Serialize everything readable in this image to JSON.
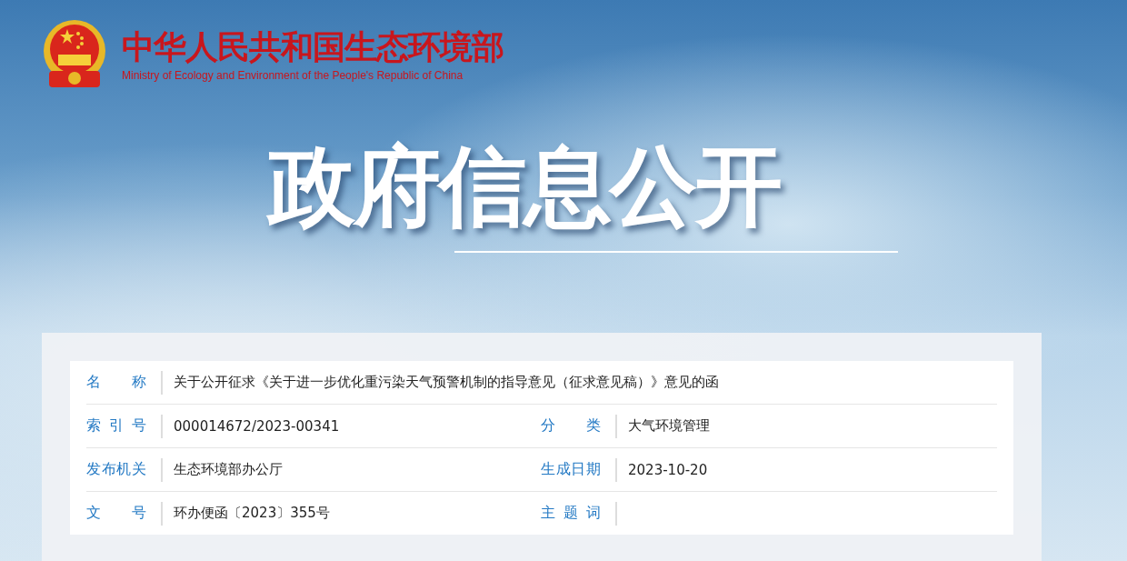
{
  "header": {
    "title": "中华人民共和国生态环境部",
    "subtitle": "Ministry of Ecology and Environment of the People's Republic of China"
  },
  "banner": {
    "title": "政府信息公开"
  },
  "info_rows": [
    [
      {
        "label": "名称",
        "value": "关于公开征求《关于进一步优化重污染天气预警机制的指导意见（征求意见稿）》意见的函"
      }
    ],
    [
      {
        "label": "索引号",
        "value": "000014672/2023-00341"
      },
      {
        "label": "分类",
        "value": "大气环境管理"
      }
    ],
    [
      {
        "label": "发布机关",
        "value": "生态环境部办公厅"
      },
      {
        "label": "生成日期",
        "value": "2023-10-20"
      }
    ],
    [
      {
        "label": "文号",
        "value": "环办便函〔2023〕355号"
      },
      {
        "label": "主题词"
      }
    ]
  ]
}
